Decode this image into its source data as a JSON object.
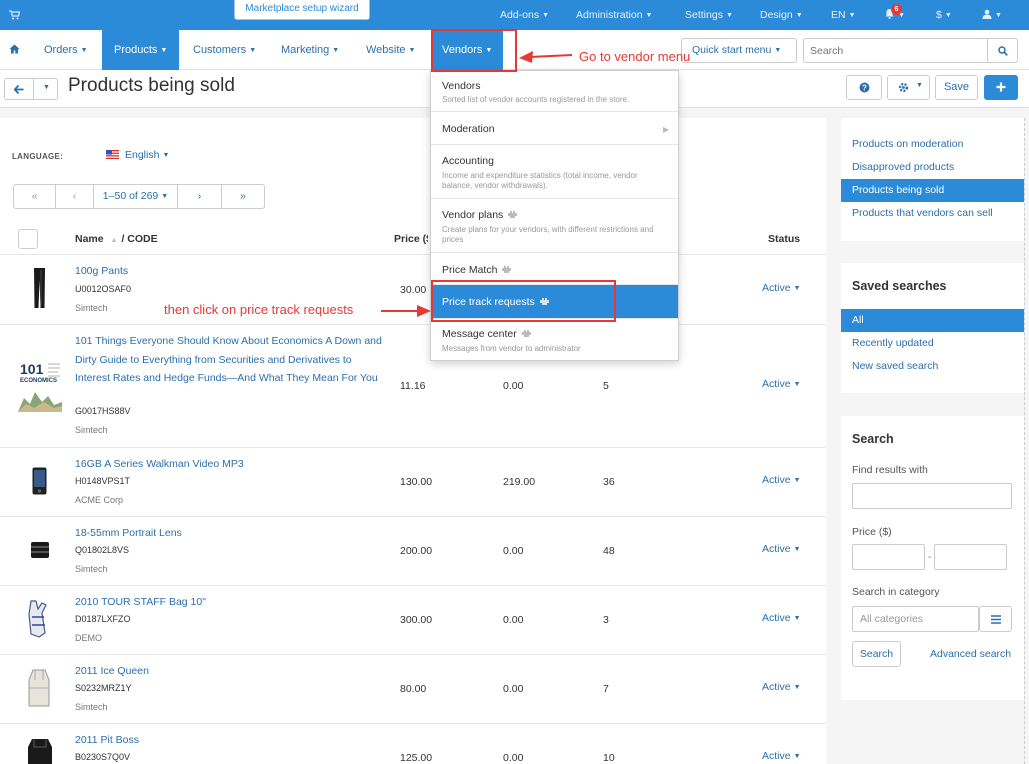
{
  "topbar": {
    "wizard_label": "Marketplace setup wizard",
    "items": [
      "Add-ons",
      "Administration",
      "Settings",
      "Design",
      "EN"
    ],
    "notifications_count": "6",
    "currency": "$"
  },
  "mainnav": {
    "items": [
      "Orders",
      "Products",
      "Customers",
      "Marketing",
      "Website",
      "Vendors"
    ],
    "quick_start": "Quick start menu",
    "search_placeholder": "Search"
  },
  "page": {
    "title": "Products being sold",
    "save_label": "Save"
  },
  "filters": {
    "language_label": "LANGUAGE:",
    "language_value": "English",
    "pagination": {
      "first": "«",
      "prev": "‹",
      "range": "1–50 of 269",
      "next": "›",
      "last": "»"
    }
  },
  "table": {
    "headers": {
      "name": "Name",
      "code": "/  CODE",
      "price": "Price ($)",
      "status": "Status"
    },
    "rows": [
      {
        "name": "100g Pants",
        "code": "U0012OSAF0",
        "vendor": "Simtech",
        "price": "30.00",
        "list_price": "",
        "quantity": "",
        "status": "Active"
      },
      {
        "name": "101 Things Everyone Should Know About Economics A Down and Dirty Guide to Everything from Securities and Derivatives to Interest Rates and Hedge Funds—And What They Mean For You",
        "code": "G0017HS88V",
        "vendor": "Simtech",
        "price": "11.16",
        "list_price": "0.00",
        "quantity": "5",
        "status": "Active"
      },
      {
        "name": "16GB A Series Walkman Video MP3",
        "code": "H0148VPS1T",
        "vendor": "ACME Corp",
        "price": "130.00",
        "list_price": "219.00",
        "quantity": "36",
        "status": "Active"
      },
      {
        "name": "18-55mm Portrait Lens",
        "code": "Q01802L8VS",
        "vendor": "Simtech",
        "price": "200.00",
        "list_price": "0.00",
        "quantity": "48",
        "status": "Active"
      },
      {
        "name": "2010 TOUR STAFF Bag 10\"",
        "code": "D0187LXFZO",
        "vendor": "DEMO",
        "price": "300.00",
        "list_price": "0.00",
        "quantity": "3",
        "status": "Active"
      },
      {
        "name": "2011 Ice Queen",
        "code": "S0232MRZ1Y",
        "vendor": "Simtech",
        "price": "80.00",
        "list_price": "0.00",
        "quantity": "7",
        "status": "Active"
      },
      {
        "name": "2011 Pit Boss",
        "code": "B0230S7Q0V",
        "vendor": "",
        "price": "125.00",
        "list_price": "0.00",
        "quantity": "10",
        "status": "Active"
      }
    ]
  },
  "book_cover": {
    "line1": "101",
    "line2": "ECONOMICS"
  },
  "vendors_menu": [
    {
      "title": "Vendors",
      "desc": "Sorted list of vendor accounts registered in the store."
    },
    {
      "title": "Moderation",
      "desc": ""
    },
    {
      "title": "Accounting",
      "desc": "Income and expenditure statistics (total income, vendor balance, vendor withdrawals)."
    },
    {
      "title": "Vendor plans",
      "desc": "Create plans for your vendors, with different restrictions and prices"
    },
    {
      "title": "Price Match",
      "desc": ""
    },
    {
      "title": "Price track requests",
      "desc": ""
    },
    {
      "title": "Message center",
      "desc": "Messages from vendor to administrator"
    }
  ],
  "annotations": {
    "vendor_menu": "Go to vendor menu",
    "price_track": "then click on price track requests"
  },
  "sidebar": {
    "views": [
      "Products on moderation",
      "Disapproved products",
      "Products being sold",
      "Products that vendors can sell"
    ],
    "saved_searches_title": "Saved searches",
    "saved_searches": [
      "All",
      "Recently updated",
      "New saved search"
    ],
    "search_title": "Search",
    "find_label": "Find results with",
    "price_label": "Price ($)",
    "category_label": "Search in category",
    "category_placeholder": "All categories",
    "search_button": "Search",
    "advanced_link": "Advanced search"
  },
  "colors": {
    "primary": "#2b8bd9",
    "link": "#2b6fab",
    "annotation": "#e53935"
  },
  "icons": [
    "cart-icon",
    "home-icon",
    "bell-icon",
    "user-icon",
    "search-icon",
    "arrow-left-icon",
    "question-icon",
    "gear-icon",
    "plus-icon",
    "flag-us-icon",
    "plug-icon",
    "menu-icon"
  ]
}
